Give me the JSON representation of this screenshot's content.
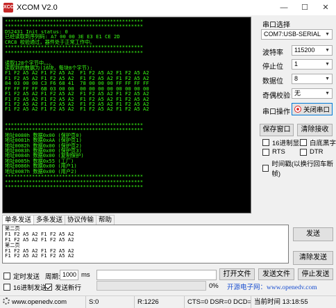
{
  "window": {
    "title": "XCOM V2.0",
    "icon_text": "XCOM",
    "minimize": "—",
    "maximize": "☐",
    "close": "✕"
  },
  "terminal": {
    "lines": [
      "**********************************************",
      "**********************************************",
      "DS2431 Init status: 0",
      "已经读取到序列码: A7 00 00 3E E3 E1 CE 2D",
      "CRC8 校验通过，器件处于正常工作中。",
      "**********************************************",
      "**********************************************",
      "",
      "读取128个字节中。。。",
      "读取到的数据为(16块，每块8个字节):",
      "F1 F2 A5 A2 F1 F2 A5 A2  F1 F2 A5 A2 F1 F2 A5 A2",
      "F1 F2 A5 A2 F1 F2 A5 A2  F1 F2 A5 A2 F1 F2 A5 A2",
      "84 03 00 00 C3 F6 68 41  78 00 00 00 FF FF FF FF",
      "FF FF FF FF 6B 03 00 00  00 00 00 00 00 00 00 00",
      "F1 F2 A5 A2 F1 F2 A5 A2  F1 F2 A5 A2 F1 F2 A5 A2",
      "F1 F2 A5 A2 F1 F2 A5 A2  F1 F2 A5 A2 F1 F2 A5 A2",
      "F1 F2 A5 A2 F1 F2 A5 A2  F1 F2 A5 A2 F1 F2 A5 A2",
      "F1 F2 A5 A2 F1 F2 A5 A2  F1 F2 A5 A2 F1 F2 A5 A2",
      "",
      "",
      "**********************************************",
      "**********************************************",
      "地址0080h 数据0x00 (保护页0)",
      "地址0081h 数据0xAA (保护页1)",
      "地址0082h 数据0x00 (保护页2)",
      "地址0083h 数据0x00 (保护页3)",
      "地址0084h 数据0x00 (复制保护)",
      "地址0085h 数据0x55 (工厂)",
      "地址0086h 数据0x00 (用户1)",
      "地址0087h 数据0x00 (用户2)",
      "**********************************************",
      "**********************************************",
      "**********************************************"
    ]
  },
  "settings": {
    "port_label": "串口选择",
    "port_value": "COM7:USB-SERIAL",
    "baud_label": "波特率",
    "baud_value": "115200",
    "stop_label": "停止位",
    "stop_value": "1",
    "data_label": "数据位",
    "data_value": "8",
    "parity_label": "奇偶校验",
    "parity_value": "无",
    "op_label": "串口操作",
    "close_port": "关闭串口",
    "dropdown": "▼"
  },
  "actions": {
    "save_window": "保存窗口",
    "clear_recv": "清除接收",
    "hex_display": "16进制显示",
    "white_black": "白底黑字",
    "rts": "RTS",
    "dtr": "DTR",
    "timestamp": "时间戳(以换行回车断帧)"
  },
  "tabs": [
    "单条发送",
    "多条发送",
    "协议传输",
    "帮助"
  ],
  "send": {
    "lines": [
      "第二页",
      "F1 F2 A5 A2 F1 F2 A5 A2",
      "F1 F2 A5 A2 F1 F2 A5 A2",
      "第二页",
      "F1 F2 A5 A2 F1 F2 A5 A2",
      "F1 F2 A5 A2 F1 F2 A5 A2"
    ],
    "send_btn": "发送",
    "clear_send": "清除发送",
    "timed_send": "定时发送",
    "period_label": "周期:",
    "period_value": "1000",
    "period_unit": "ms",
    "hex_send": "16进制发送",
    "newline_send": "发送新行",
    "open_file": "打开文件",
    "send_file": "发送文件",
    "stop_send": "停止发送",
    "progress_percent": 0,
    "progress_text": "0%",
    "footer_link": "开源电子网：www.openedv.com"
  },
  "status": {
    "site": "www.openedv.com",
    "s": "S:0",
    "r": "R:1226",
    "lines": "CTS=0 DSR=0 DCD=0",
    "time": "当前时间 13:18:55"
  }
}
